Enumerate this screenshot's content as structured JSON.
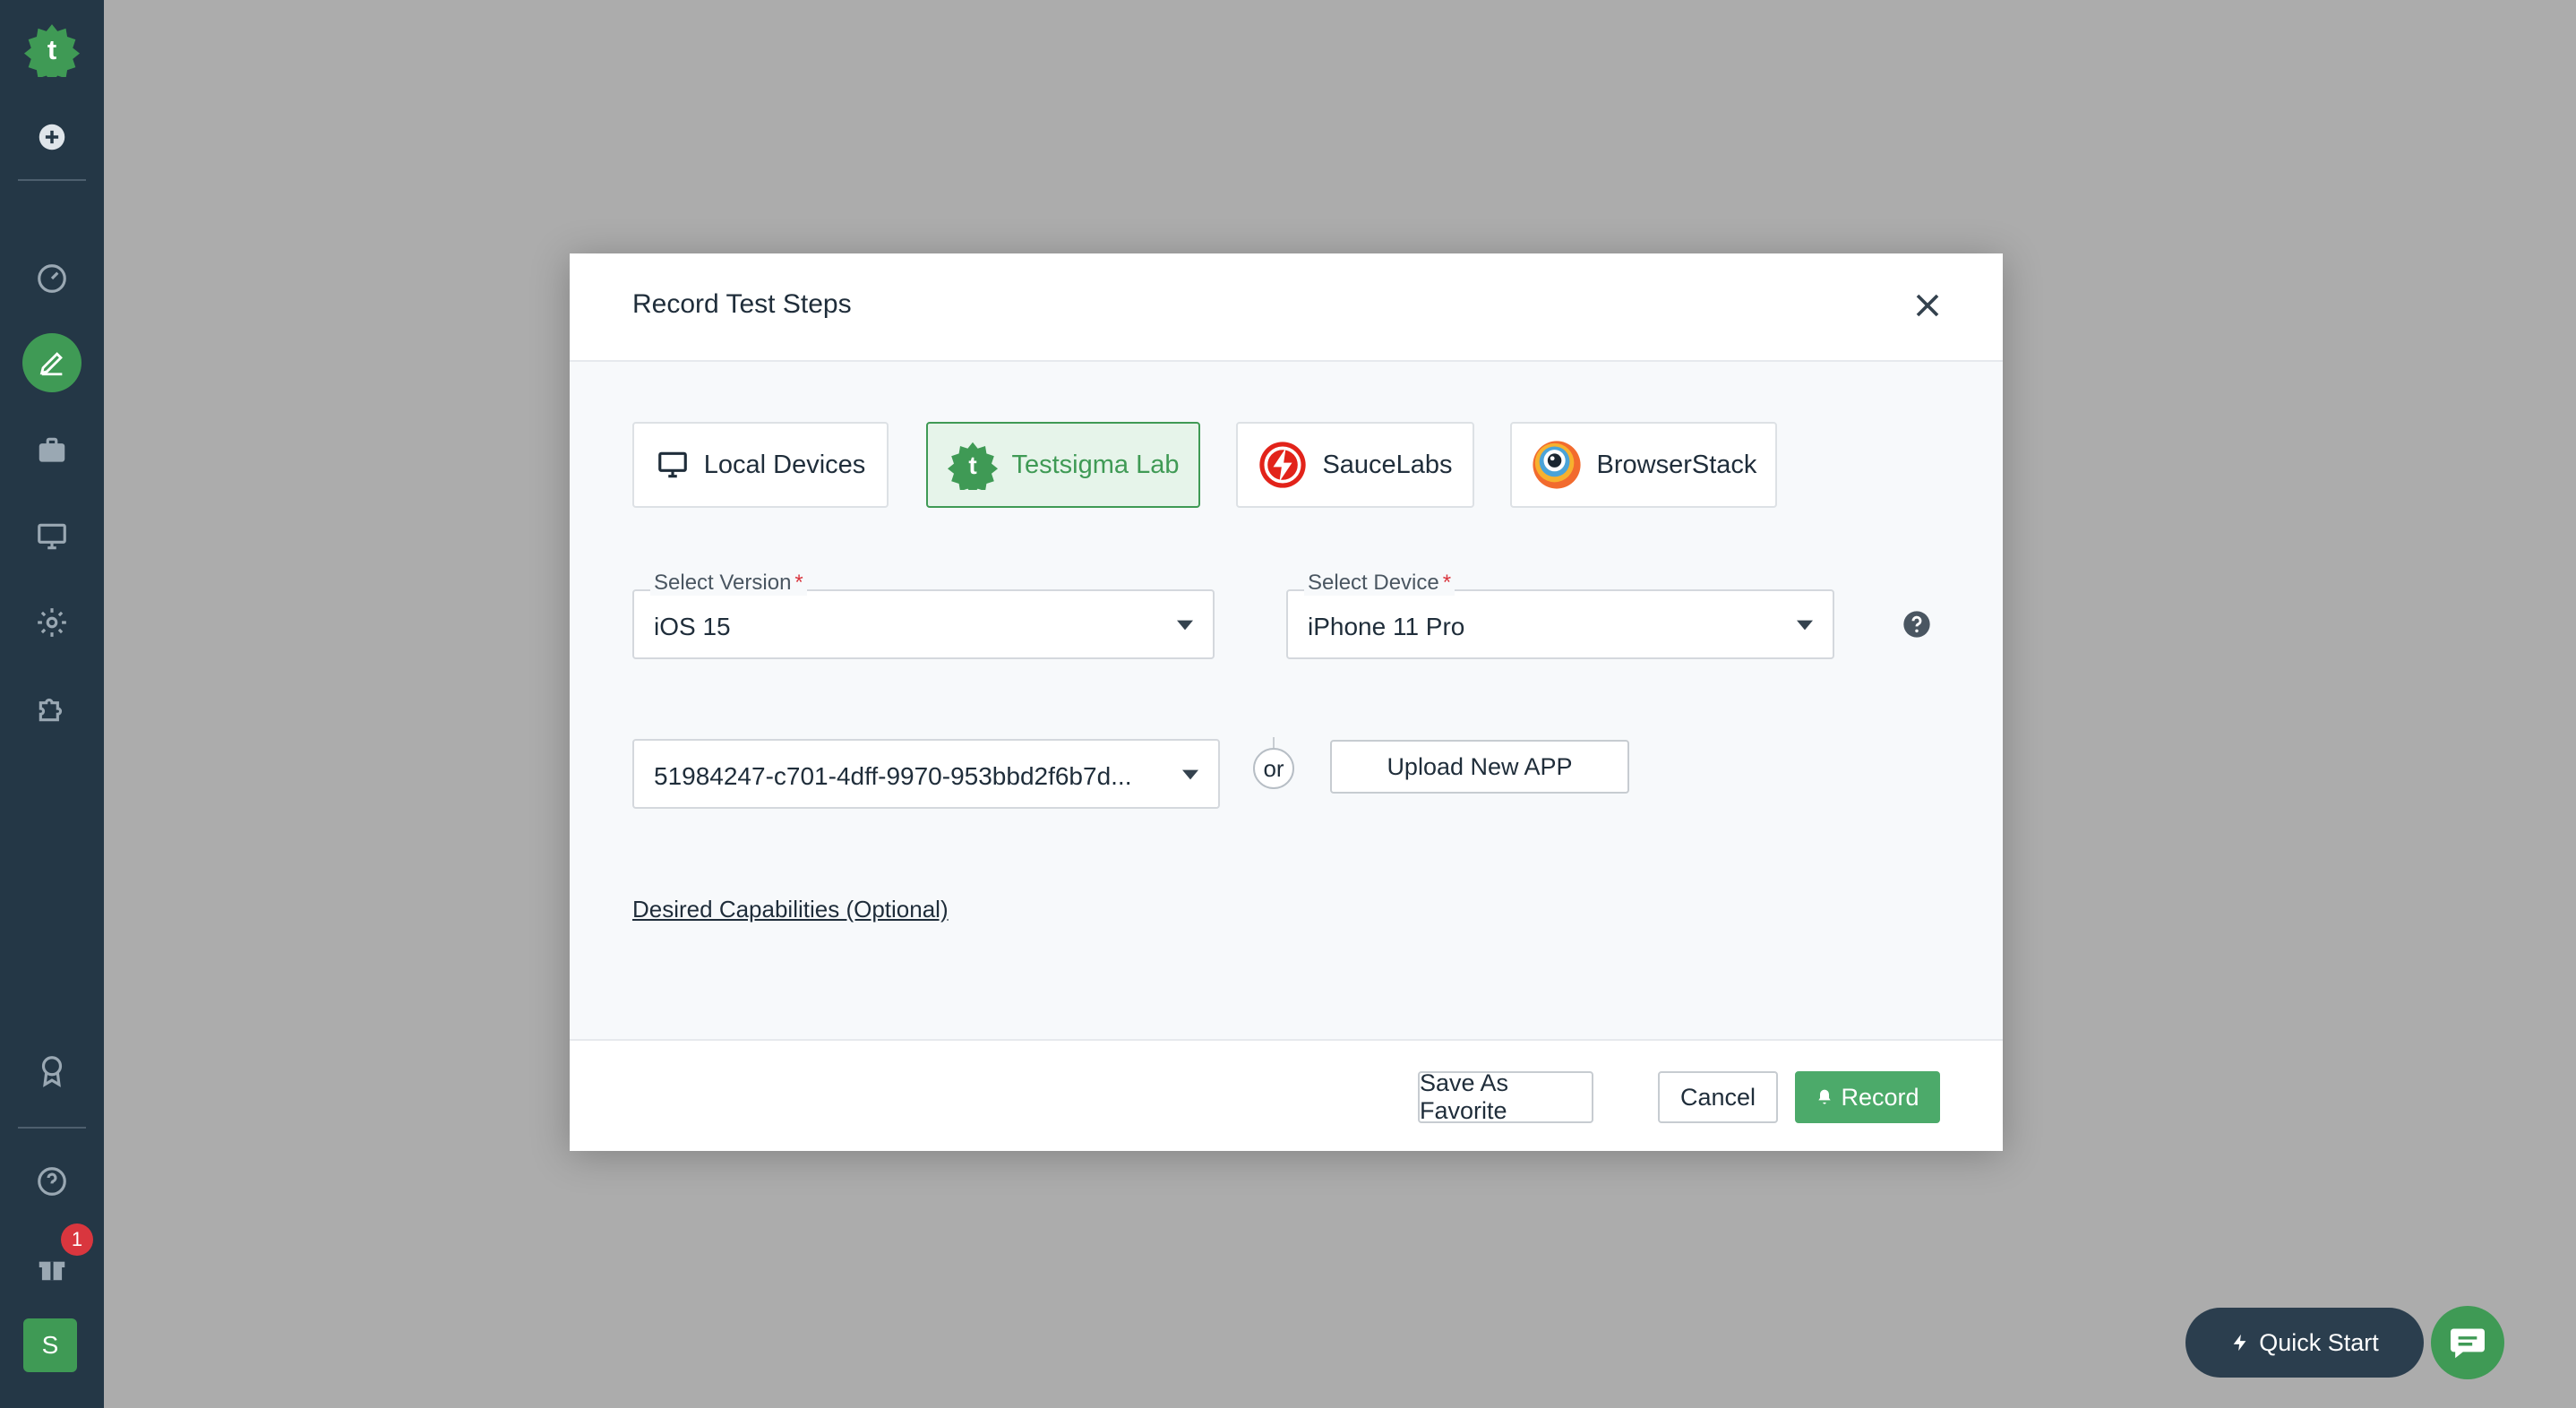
{
  "sidebar": {
    "logo_letter": "t",
    "items": [
      {
        "icon": "plus-circle-icon"
      },
      {
        "icon": "dashboard-gauge-icon"
      },
      {
        "icon": "pencil-icon",
        "active": true
      },
      {
        "icon": "briefcase-icon"
      },
      {
        "icon": "monitor-icon"
      },
      {
        "icon": "settings-gear-icon"
      },
      {
        "icon": "puzzle-icon"
      },
      {
        "icon": "award-icon"
      },
      {
        "icon": "help-icon"
      },
      {
        "icon": "gift-icon"
      }
    ],
    "gift_badge": "1",
    "avatar_letter": "S"
  },
  "modal": {
    "title": "Record Test Steps",
    "providers": [
      {
        "label": "Local Devices",
        "icon": "monitor-icon",
        "active": false
      },
      {
        "label": "Testsigma Lab",
        "icon": "testsigma-logo-icon",
        "active": true
      },
      {
        "label": "SauceLabs",
        "icon": "saucelabs-logo-icon",
        "active": false
      },
      {
        "label": "BrowserStack",
        "icon": "browserstack-logo-icon",
        "active": false
      }
    ],
    "version": {
      "label": "Select Version",
      "required_mark": "*",
      "value": "iOS 15"
    },
    "device": {
      "label": "Select Device",
      "required_mark": "*",
      "value": "iPhone 11 Pro"
    },
    "app": {
      "value": "51984247-c701-4dff-9970-953bbd2f6b7d..."
    },
    "or_text": "or",
    "upload_label": "Upload New APP",
    "capabilities_link": "Desired Capabilities (Optional)",
    "footer": {
      "save_favorite": "Save As Favorite",
      "cancel": "Cancel",
      "record": "Record"
    }
  },
  "quick_start_label": "Quick Start",
  "colors": {
    "accent": "#3f9a55",
    "sidebar_bg": "#243746",
    "overlay_bg": "#acacac"
  }
}
